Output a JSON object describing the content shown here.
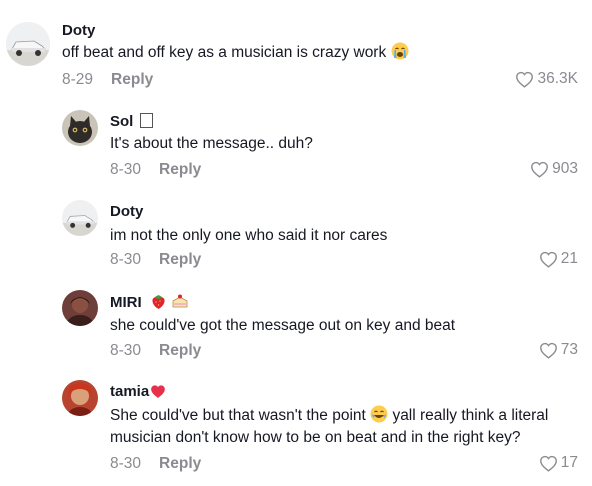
{
  "comments": [
    {
      "name": "Doty",
      "name_suffix": "",
      "text": [
        "off beat and off key as a musician is crazy work"
      ],
      "trailing_emoji": "crying-face",
      "date": "8-29",
      "reply_label": "Reply",
      "likes": "36.3K",
      "avatar": "car-avatar"
    },
    {
      "name": "Sol",
      "name_suffix": "🪐",
      "text": [
        "It's about the message.. duh?"
      ],
      "date": "8-30",
      "reply_label": "Reply",
      "likes": "903",
      "avatar": "cat-avatar"
    },
    {
      "name": "Doty",
      "name_suffix": "",
      "text": [
        "im not the only one who said it nor cares"
      ],
      "date": "8-30",
      "reply_label": "Reply",
      "likes": "21",
      "avatar": "car-avatar"
    },
    {
      "name": "MIRI",
      "name_suffix": "",
      "name_emojis": [
        "strawberry",
        "cake"
      ],
      "text": [
        "she could've got the message out on key and beat"
      ],
      "date": "8-30",
      "reply_label": "Reply",
      "likes": "73",
      "avatar": "person-avatar"
    },
    {
      "name": "tamia",
      "name_suffix": "",
      "name_emojis": [
        "heart"
      ],
      "text": [
        "She could've but that wasn't the point",
        "yall really think a literal",
        "musician don't know how to be on beat and in the right key?"
      ],
      "inline_emoji": "laughing-face",
      "date": "8-30",
      "reply_label": "Reply",
      "likes": "17",
      "avatar": "person-red-avatar"
    }
  ],
  "icons": {
    "like": "heart-outline-icon"
  },
  "colors": {
    "muted": "#8a8b91",
    "text": "#161823",
    "background": "#ffffff"
  }
}
